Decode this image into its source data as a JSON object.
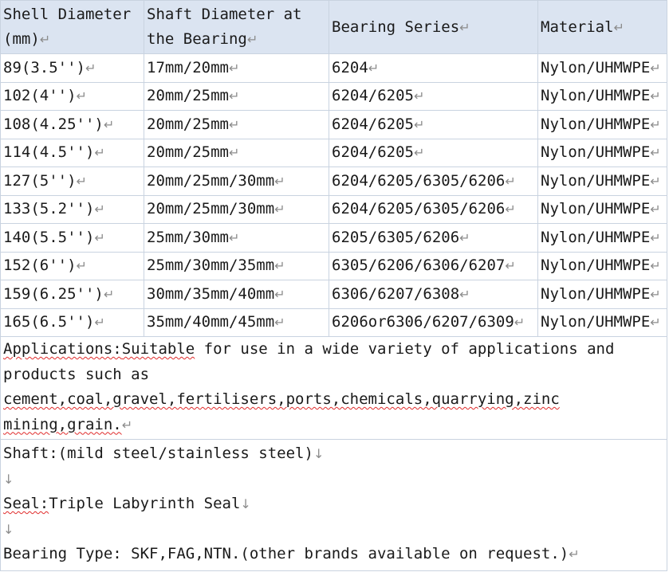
{
  "table": {
    "headers": [
      "Shell Diameter (mm)",
      "Shaft Diameter at the Bearing",
      "Bearing Series",
      "Material"
    ],
    "rows": [
      [
        "89(3.5'')",
        "17mm/20mm",
        "6204",
        "Nylon/UHMWPE"
      ],
      [
        "102(4'')",
        "20mm/25mm",
        "6204/6205",
        "Nylon/UHMWPE"
      ],
      [
        "108(4.25'')",
        "20mm/25mm",
        "6204/6205",
        "Nylon/UHMWPE"
      ],
      [
        "114(4.5'')",
        "20mm/25mm",
        "6204/6205",
        "Nylon/UHMWPE"
      ],
      [
        "127(5'')",
        "20mm/25mm/30mm",
        "6204/6205/6305/6206",
        "Nylon/UHMWPE"
      ],
      [
        "133(5.2'')",
        "20mm/25mm/30mm",
        "6204/6205/6305/6206",
        "Nylon/UHMWPE"
      ],
      [
        "140(5.5'')",
        "25mm/30mm",
        "6205/6305/6206",
        "Nylon/UHMWPE"
      ],
      [
        "152(6'')",
        "25mm/30mm/35mm",
        "6305/6206/6306/6207",
        "Nylon/UHMWPE"
      ],
      [
        "159(6.25'')",
        "30mm/35mm/40mm",
        "6306/6207/6308",
        "Nylon/UHMWPE"
      ],
      [
        "165(6.5'')",
        "35mm/40mm/45mm",
        "6206or6306/6207/6309",
        "Nylon/UHMWPE"
      ]
    ]
  },
  "applications": {
    "label": "Applications:",
    "squiggle_word": "Suitable",
    "line1_rest": " for use in a wide variety of applications and",
    "line2": "products such as",
    "line3": "cement,coal,gravel,fertilisers,ports,chemicals,quarrying,zinc",
    "line4": "mining,grain."
  },
  "notes": {
    "shaft": "Shaft:(mild steel/stainless steel)",
    "seal_label": "Seal:",
    "seal_value": "Triple Labyrinth Seal",
    "bearing": "Bearing Type: SKF,FAG,NTN.(other brands available on request.)"
  },
  "marks": {
    "paragraph": "↵",
    "linebreak": "↓"
  }
}
